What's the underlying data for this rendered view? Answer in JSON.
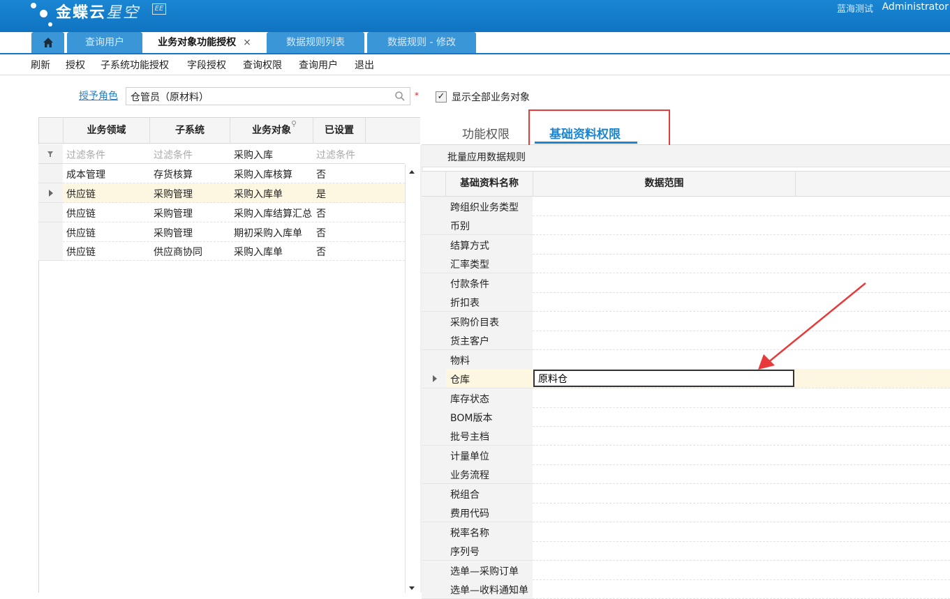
{
  "header": {
    "logo_main": "金蝶云",
    "logo_sub": "星空",
    "logo_badge": "EE",
    "org_name": "蓝海测试",
    "user_name": "Administrator"
  },
  "tabs": [
    {
      "label": "查询用户"
    },
    {
      "label": "业务对象功能授权",
      "close": "×"
    },
    {
      "label": "数据规则列表"
    },
    {
      "label": "数据规则 - 修改"
    }
  ],
  "toolbar": [
    "刷新",
    "授权",
    "子系统功能授权",
    "字段授权",
    "查询权限",
    "查询用户",
    "退出"
  ],
  "role": {
    "label": "授予角色",
    "value": "仓管员（原材料）",
    "required_mark": "*"
  },
  "show_all": {
    "label": "显示全部业务对象",
    "checked_mark": "✓"
  },
  "left_grid": {
    "columns": [
      "业务领域",
      "子系统",
      "业务对象",
      "已设置"
    ],
    "filter": {
      "c1": "过滤条件",
      "c2": "过滤条件",
      "c3": "采购入库",
      "c4": "过滤条件"
    },
    "rows": [
      {
        "domain": "成本管理",
        "subsystem": "存货核算",
        "object": "采购入库核算",
        "set": "否"
      },
      {
        "domain": "供应链",
        "subsystem": "采购管理",
        "object": "采购入库单",
        "set": "是"
      },
      {
        "domain": "供应链",
        "subsystem": "采购管理",
        "object": "采购入库结算汇总",
        "set": "否"
      },
      {
        "domain": "供应链",
        "subsystem": "采购管理",
        "object": "期初采购入库单",
        "set": "否"
      },
      {
        "domain": "供应链",
        "subsystem": "供应商协同",
        "object": "采购入库单",
        "set": "否"
      }
    ]
  },
  "right_tabs": [
    "功能权限",
    "基础资料权限"
  ],
  "batch_label": "批量应用数据规则",
  "right_grid": {
    "columns": [
      "基础资料名称",
      "数据范围"
    ],
    "rows": [
      "跨组织业务类型",
      "币别",
      "结算方式",
      "汇率类型",
      "付款条件",
      "折扣表",
      "采购价目表",
      "货主客户",
      "物料",
      "仓库",
      "库存状态",
      "BOM版本",
      "批号主档",
      "计量单位",
      "业务流程",
      "税组合",
      "费用代码",
      "税率名称",
      "序列号",
      "选单—采购订单",
      "选单—收料通知单"
    ],
    "selected_value": "原料仓"
  },
  "colors": {
    "header_blue": "#1a86d3",
    "annotation_red": "#e83a3a",
    "selected_row": "#fdf6e1"
  }
}
